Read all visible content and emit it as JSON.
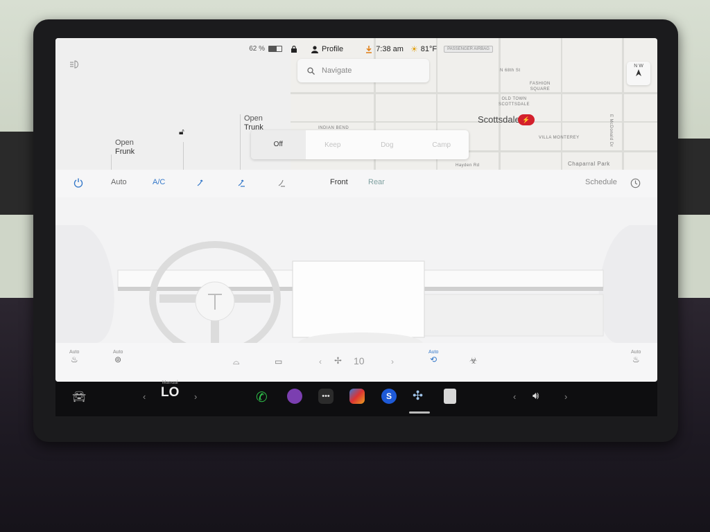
{
  "status": {
    "battery_percent": "62 %",
    "battery_level": 0.62,
    "profile_label": "Profile",
    "time": "7:38 am",
    "temperature": "81°F",
    "airbag_label": "PASSENGER AIRBAG"
  },
  "car": {
    "frunk_line1": "Open",
    "frunk_line2": "Frunk",
    "trunk_line1": "Open",
    "trunk_line2": "Trunk"
  },
  "map": {
    "search_placeholder": "Navigate",
    "city": "Scottsdale",
    "compass_label": "N W",
    "labels": {
      "n68": "N 68th St",
      "fashion": "FASHION\nSQUARE",
      "oldtown": "OLD TOWN\nSCOTTSDALE",
      "villa": "VILLA MONTEREY",
      "chaparral": "Chaparral Park",
      "hayden": "Hayden Rd",
      "mcdonald": "E McDonald Dr",
      "indian": "INDIAN BEND"
    }
  },
  "modes": {
    "off": "Off",
    "keep": "Keep",
    "dog": "Dog",
    "camp": "Camp"
  },
  "climate": {
    "auto": "Auto",
    "ac": "A/C",
    "front": "Front",
    "rear": "Rear",
    "schedule": "Schedule",
    "fan_speed": "10",
    "seat_auto_left": "Auto",
    "wheel_auto": "Auto",
    "recirc_auto": "Auto",
    "seat_auto_right": "Auto"
  },
  "dock": {
    "temp_mode_label": "Manual",
    "temperature": "LO"
  },
  "colors": {
    "accent_blue": "#3478c9",
    "supercharger_red": "#d3202c",
    "phone_green": "#2fbf4a"
  }
}
